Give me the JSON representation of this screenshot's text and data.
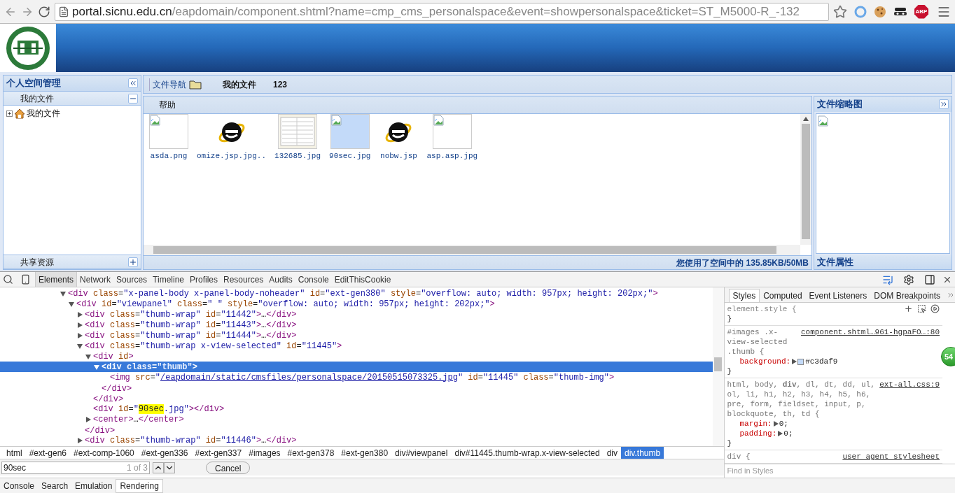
{
  "browser": {
    "url_host": "portal.sicnu.edu.cn",
    "url_path": "/eapdomain/component.shtml?name=cmp_cms_personalspace&event=showpersonalspace&ticket=ST_M5000-R_-132",
    "extensions": [
      {
        "kind": "circle"
      },
      {
        "kind": "cookie"
      },
      {
        "kind": "mask"
      },
      {
        "kind": "abp",
        "label": "ABP"
      }
    ]
  },
  "left_panel": {
    "title": "个人空间管理",
    "sections": [
      {
        "title": "我的文件",
        "expanded": true,
        "tree": [
          {
            "label": "我的文件",
            "expanded": false
          }
        ]
      },
      {
        "title": "共享资源",
        "expanded": false
      }
    ]
  },
  "toolbar": {
    "nav_label": "文件导航",
    "folder": "我的文件",
    "count": "123"
  },
  "files_panel": {
    "menu": "帮助",
    "files": [
      {
        "name": "asda.png",
        "kind": "broken",
        "selected": false
      },
      {
        "name": "omize.jsp.jpg..",
        "kind": "ie",
        "selected": false
      },
      {
        "name": "132685.jpg",
        "kind": "shot",
        "selected": false
      },
      {
        "name": "90sec.jpg",
        "kind": "broken",
        "selected": true
      },
      {
        "name": "nobw.jsp",
        "kind": "ie",
        "selected": false
      },
      {
        "name": "asp.asp.jpg",
        "kind": "broken",
        "selected": false
      }
    ],
    "status": "您使用了空间中的 135.85KB/50MB"
  },
  "right_panel": {
    "title": "文件缩略图",
    "footer": "文件属性"
  },
  "devtools": {
    "tabs": [
      {
        "label": "Elements",
        "selected": true
      },
      {
        "label": "Network",
        "selected": false
      },
      {
        "label": "Sources",
        "selected": false
      },
      {
        "label": "Timeline",
        "selected": false
      },
      {
        "label": "Profiles",
        "selected": false
      },
      {
        "label": "Resources",
        "selected": false
      },
      {
        "label": "Audits",
        "selected": false
      },
      {
        "label": "Console",
        "selected": false
      },
      {
        "label": "EditThisCookie",
        "selected": false
      }
    ],
    "nodes": [
      {
        "selected": false,
        "expanded": true,
        "tokens": [
          {
            "t": "<div",
            "kind": "tag"
          },
          {
            "t": " class",
            "kind": "attr"
          },
          {
            "t": "=",
            "kind": "plain"
          },
          {
            "t": "\"x-panel-body x-panel-body-noheader\"",
            "kind": "val"
          },
          {
            "t": " id",
            "kind": "attr"
          },
          {
            "t": "=",
            "kind": "plain"
          },
          {
            "t": "\"ext-gen380\"",
            "kind": "val"
          },
          {
            "t": " style",
            "kind": "attr"
          },
          {
            "t": "=",
            "kind": "plain"
          },
          {
            "t": "\"overflow: auto; width: 957px; height: 202px;\"",
            "kind": "val"
          },
          {
            "t": ">",
            "kind": "tag"
          }
        ],
        "children": [
          {
            "selected": false,
            "expanded": true,
            "tokens": [
              {
                "t": "<div",
                "kind": "tag"
              },
              {
                "t": " id",
                "kind": "attr"
              },
              {
                "t": "=",
                "kind": "plain"
              },
              {
                "t": "\"viewpanel\"",
                "kind": "val"
              },
              {
                "t": " class",
                "kind": "attr"
              },
              {
                "t": "=",
                "kind": "plain"
              },
              {
                "t": "\" \"",
                "kind": "val"
              },
              {
                "t": " style",
                "kind": "attr"
              },
              {
                "t": "=",
                "kind": "plain"
              },
              {
                "t": "\"overflow: auto; width: 957px; height: 202px;\"",
                "kind": "val"
              },
              {
                "t": ">",
                "kind": "tag"
              }
            ],
            "children": [
              {
                "selected": false,
                "expanded": false,
                "tokens": [
                  {
                    "t": "<div",
                    "kind": "tag"
                  },
                  {
                    "t": " class",
                    "kind": "attr"
                  },
                  {
                    "t": "=",
                    "kind": "plain"
                  },
                  {
                    "t": "\"thumb-wrap\"",
                    "kind": "val"
                  },
                  {
                    "t": " id",
                    "kind": "attr"
                  },
                  {
                    "t": "=",
                    "kind": "plain"
                  },
                  {
                    "t": "\"11442\"",
                    "kind": "val"
                  },
                  {
                    "t": ">",
                    "kind": "tag"
                  },
                  {
                    "t": "…",
                    "kind": "plain"
                  },
                  {
                    "t": "</div>",
                    "kind": "tag"
                  }
                ]
              },
              {
                "selected": false,
                "expanded": false,
                "tokens": [
                  {
                    "t": "<div",
                    "kind": "tag"
                  },
                  {
                    "t": " class",
                    "kind": "attr"
                  },
                  {
                    "t": "=",
                    "kind": "plain"
                  },
                  {
                    "t": "\"thumb-wrap\"",
                    "kind": "val"
                  },
                  {
                    "t": " id",
                    "kind": "attr"
                  },
                  {
                    "t": "=",
                    "kind": "plain"
                  },
                  {
                    "t": "\"11443\"",
                    "kind": "val"
                  },
                  {
                    "t": ">",
                    "kind": "tag"
                  },
                  {
                    "t": "…",
                    "kind": "plain"
                  },
                  {
                    "t": "</div>",
                    "kind": "tag"
                  }
                ]
              },
              {
                "selected": false,
                "expanded": false,
                "tokens": [
                  {
                    "t": "<div",
                    "kind": "tag"
                  },
                  {
                    "t": " class",
                    "kind": "attr"
                  },
                  {
                    "t": "=",
                    "kind": "plain"
                  },
                  {
                    "t": "\"thumb-wrap\"",
                    "kind": "val"
                  },
                  {
                    "t": " id",
                    "kind": "attr"
                  },
                  {
                    "t": "=",
                    "kind": "plain"
                  },
                  {
                    "t": "\"11444\"",
                    "kind": "val"
                  },
                  {
                    "t": ">",
                    "kind": "tag"
                  },
                  {
                    "t": "…",
                    "kind": "plain"
                  },
                  {
                    "t": "</div>",
                    "kind": "tag"
                  }
                ]
              },
              {
                "selected": false,
                "expanded": true,
                "close": "</div>",
                "tokens": [
                  {
                    "t": "<div",
                    "kind": "tag"
                  },
                  {
                    "t": " class",
                    "kind": "attr"
                  },
                  {
                    "t": "=",
                    "kind": "plain"
                  },
                  {
                    "t": "\"thumb-wrap x-view-selected\"",
                    "kind": "val"
                  },
                  {
                    "t": " id",
                    "kind": "attr"
                  },
                  {
                    "t": "=",
                    "kind": "plain"
                  },
                  {
                    "t": "\"11445\"",
                    "kind": "val"
                  },
                  {
                    "t": ">",
                    "kind": "tag"
                  }
                ],
                "children": [
                  {
                    "selected": false,
                    "expanded": true,
                    "close": "</div>",
                    "tokens": [
                      {
                        "t": "<div",
                        "kind": "tag"
                      },
                      {
                        "t": " id",
                        "kind": "attr"
                      },
                      {
                        "t": ">",
                        "kind": "tag"
                      }
                    ],
                    "children": [
                      {
                        "selected": true,
                        "expanded": true,
                        "close": "</div>",
                        "tokens": [
                          {
                            "t": "<div",
                            "kind": "tag"
                          },
                          {
                            "t": " class",
                            "kind": "attr"
                          },
                          {
                            "t": "=",
                            "kind": "plain"
                          },
                          {
                            "t": "\"thumb\"",
                            "kind": "val"
                          },
                          {
                            "t": ">",
                            "kind": "tag"
                          }
                        ],
                        "children": [
                          {
                            "selected": false,
                            "tokens": [
                              {
                                "t": "<img",
                                "kind": "tag"
                              },
                              {
                                "t": " src",
                                "kind": "attr"
                              },
                              {
                                "t": "=",
                                "kind": "plain"
                              },
                              {
                                "t": "\"",
                                "kind": "val"
                              },
                              {
                                "t": "/eapdomain/static/cmsfiles/personalspace/20150515073325.jpg",
                                "kind": "link"
                              },
                              {
                                "t": "\"",
                                "kind": "val"
                              },
                              {
                                "t": " id",
                                "kind": "attr"
                              },
                              {
                                "t": "=",
                                "kind": "plain"
                              },
                              {
                                "t": "\"11445\"",
                                "kind": "val"
                              },
                              {
                                "t": " class",
                                "kind": "attr"
                              },
                              {
                                "t": "=",
                                "kind": "plain"
                              },
                              {
                                "t": "\"thumb-img\"",
                                "kind": "val"
                              },
                              {
                                "t": ">",
                                "kind": "tag"
                              }
                            ]
                          }
                        ]
                      }
                    ]
                  },
                  {
                    "selected": false,
                    "tokens": [
                      {
                        "t": "<div",
                        "kind": "tag"
                      },
                      {
                        "t": " id",
                        "kind": "attr"
                      },
                      {
                        "t": "=",
                        "kind": "plain"
                      },
                      {
                        "t": "\"",
                        "kind": "val"
                      },
                      {
                        "t": "90sec",
                        "kind": "match"
                      },
                      {
                        "t": ".jpg\"",
                        "kind": "val"
                      },
                      {
                        "t": ">",
                        "kind": "tag"
                      },
                      {
                        "t": "</div>",
                        "kind": "tag"
                      }
                    ]
                  },
                  {
                    "selected": false,
                    "expanded": false,
                    "tokens": [
                      {
                        "t": "<center>",
                        "kind": "tag"
                      },
                      {
                        "t": "…",
                        "kind": "plain"
                      },
                      {
                        "t": "</center>",
                        "kind": "tag"
                      }
                    ]
                  }
                ]
              },
              {
                "selected": false,
                "expanded": false,
                "tokens": [
                  {
                    "t": "<div",
                    "kind": "tag"
                  },
                  {
                    "t": " class",
                    "kind": "attr"
                  },
                  {
                    "t": "=",
                    "kind": "plain"
                  },
                  {
                    "t": "\"thumb-wrap\"",
                    "kind": "val"
                  },
                  {
                    "t": " id",
                    "kind": "attr"
                  },
                  {
                    "t": "=",
                    "kind": "plain"
                  },
                  {
                    "t": "\"11446\"",
                    "kind": "val"
                  },
                  {
                    "t": ">",
                    "kind": "tag"
                  },
                  {
                    "t": "…",
                    "kind": "plain"
                  },
                  {
                    "t": "</div>",
                    "kind": "tag"
                  }
                ]
              }
            ]
          }
        ]
      }
    ],
    "breadcrumbs": [
      {
        "label": "html",
        "selected": false
      },
      {
        "label": "#ext-gen6",
        "selected": false
      },
      {
        "label": "#ext-comp-1060",
        "selected": false
      },
      {
        "label": "#ext-gen336",
        "selected": false
      },
      {
        "label": "#ext-gen337",
        "selected": false
      },
      {
        "label": "#images",
        "selected": false
      },
      {
        "label": "#ext-gen378",
        "selected": false
      },
      {
        "label": "#ext-gen380",
        "selected": false
      },
      {
        "label": "div#viewpanel",
        "selected": false
      },
      {
        "label": "div#11445.thumb-wrap.x-view-selected",
        "selected": false
      },
      {
        "label": "div",
        "selected": false
      },
      {
        "label": "div.thumb",
        "selected": true
      }
    ],
    "find": {
      "value": "90sec",
      "count": "1 of 3",
      "cancel": "Cancel"
    },
    "styles_tabs": [
      {
        "label": "Styles",
        "selected": true
      },
      {
        "label": "Computed",
        "selected": false
      },
      {
        "label": "Event Listeners",
        "selected": false
      },
      {
        "label": "DOM Breakpoints",
        "selected": false
      }
    ],
    "rules": [
      {
        "kind": "inline",
        "selector": "element.style {",
        "close": "}"
      },
      {
        "kind": "rule",
        "selector": "#images .x-view-selected .thumb {",
        "source": "component.shtml…961-hgpaFO…:80",
        "close": "}",
        "props": [
          {
            "name": "background:",
            "value": "#c3daf9",
            "swatch": true
          }
        ]
      },
      {
        "kind": "rule",
        "selector": "html, body, **div**, dl, dt, dd, ul, ol, li, h1, h2, h3, h4, h5, h6, pre, form, fieldset, input, p, blockquote, th, td {",
        "source": "ext-all.css:9",
        "close": "}",
        "props": [
          {
            "name": "margin:",
            "value": "0;"
          },
          {
            "name": "padding:",
            "value": "0;"
          }
        ]
      },
      {
        "kind": "rule",
        "selector": "div {",
        "source": "user agent stylesheet"
      }
    ],
    "find_styles_placeholder": "Find in Styles",
    "badge": "54",
    "drawer_tabs": [
      {
        "label": "Console",
        "selected": false
      },
      {
        "label": "Search",
        "selected": false
      },
      {
        "label": "Emulation",
        "selected": false
      },
      {
        "label": "Rendering",
        "selected": true
      }
    ]
  }
}
